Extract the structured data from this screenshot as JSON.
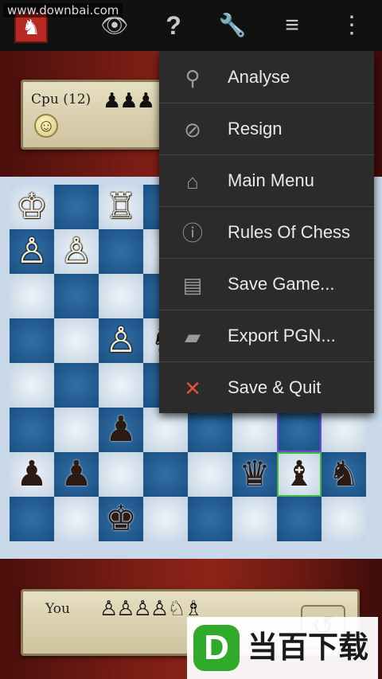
{
  "watermark": "www.downbai.com",
  "toolbar": {
    "icons": [
      "app-logo-icon",
      "eye-icon",
      "help-icon",
      "wrench-icon",
      "sort-icon",
      "overflow-icon"
    ]
  },
  "top_player": {
    "name": "Cpu (12)",
    "captured": "♟♟♟",
    "mood_icon": "smiley-icon"
  },
  "bottom_player": {
    "name": "You",
    "captured": "♙♙♙♙♘♗"
  },
  "menu": {
    "items": [
      {
        "label": "Analyse",
        "icon": "magnifier-icon"
      },
      {
        "label": "Resign",
        "icon": "no-entry-icon"
      },
      {
        "label": "Main Menu",
        "icon": "home-icon"
      },
      {
        "label": "Rules Of Chess",
        "icon": "info-icon"
      },
      {
        "label": "Save Game...",
        "icon": "floppy-icon"
      },
      {
        "label": "Export PGN...",
        "icon": "folder-icon"
      },
      {
        "label": "Save & Quit",
        "icon": "close-x-icon"
      }
    ]
  },
  "board": {
    "pieces": [
      {
        "row": 0,
        "col": 0,
        "glyph": "♔",
        "color": "w"
      },
      {
        "row": 0,
        "col": 2,
        "glyph": "♖",
        "color": "w"
      },
      {
        "row": 1,
        "col": 0,
        "glyph": "♙",
        "color": "w"
      },
      {
        "row": 1,
        "col": 1,
        "glyph": "♙",
        "color": "w"
      },
      {
        "row": 3,
        "col": 2,
        "glyph": "♙",
        "color": "w"
      },
      {
        "row": 3,
        "col": 3,
        "glyph": "♞",
        "color": "b"
      },
      {
        "row": 5,
        "col": 2,
        "glyph": "♟",
        "color": "b"
      },
      {
        "row": 6,
        "col": 0,
        "glyph": "♟",
        "color": "b"
      },
      {
        "row": 6,
        "col": 1,
        "glyph": "♟",
        "color": "b"
      },
      {
        "row": 6,
        "col": 5,
        "glyph": "♛",
        "color": "b"
      },
      {
        "row": 6,
        "col": 6,
        "glyph": "♝",
        "color": "b"
      },
      {
        "row": 6,
        "col": 7,
        "glyph": "♞",
        "color": "b"
      },
      {
        "row": 7,
        "col": 2,
        "glyph": "♚",
        "color": "b"
      }
    ],
    "highlight_last_move_from": {
      "row": 5,
      "col": 6
    },
    "highlight_last_move_to": {
      "row": 6,
      "col": 6
    }
  },
  "brand": {
    "logo": "D",
    "text": "当百下载"
  },
  "undo_icon": "undo-icon"
}
